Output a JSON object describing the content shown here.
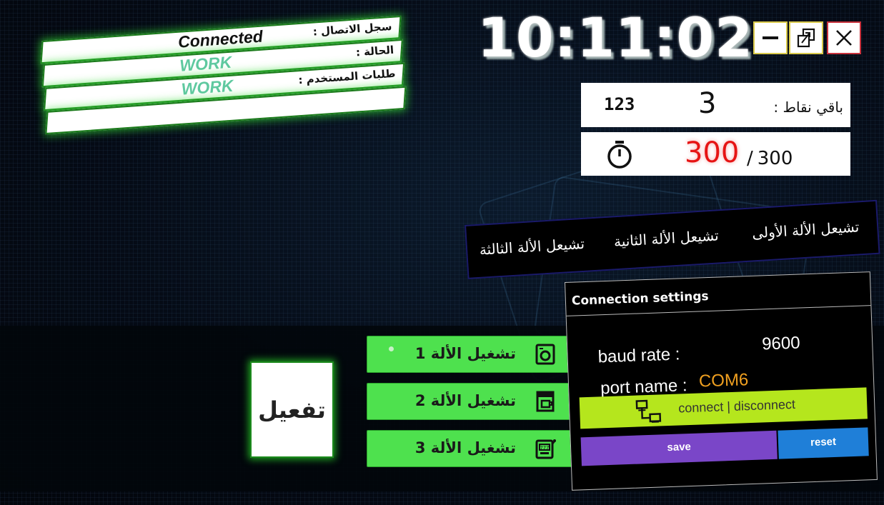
{
  "status": {
    "rows": [
      {
        "label": "سجل الاتصال :",
        "value": "Connected"
      },
      {
        "label": "الحالة :",
        "value": "WORK"
      },
      {
        "label": "طلبات المستخدم :",
        "value": "WORK"
      },
      {
        "label": "",
        "value": ""
      }
    ]
  },
  "clock": {
    "time": "10:11:02"
  },
  "window_controls": {
    "minimize": "minimize-icon",
    "maximize": "restore-icon",
    "close": "close-icon"
  },
  "points": {
    "label": "باقي نقاط :",
    "value": "3",
    "code": "123"
  },
  "timer": {
    "icon": "stopwatch-icon",
    "current": "300",
    "separator": "/",
    "total": "300"
  },
  "tabs": [
    {
      "label": "تشيعل الألة الأولى"
    },
    {
      "label": "تشيعل الألة الثانية"
    },
    {
      "label": "تشيعل الألة الثالثة"
    }
  ],
  "run_buttons": [
    {
      "label": "تشغيل الألة 1",
      "icon": "washing-machine-icon"
    },
    {
      "label": "تشغيل الألة 2",
      "icon": "coffee-machine-icon"
    },
    {
      "label": "تشغيل الألة 3",
      "icon": "slot-machine-icon"
    }
  ],
  "activate": {
    "label": "تفعيل"
  },
  "connection": {
    "title": "Connection settings",
    "baud_label": "baud rate :",
    "baud_value": "9600",
    "port_label": "port name :",
    "port_value": "COM6",
    "connect_label": "connect | disconnect",
    "connect_icon": "network-icon",
    "save_label": "save",
    "reset_label": "reset"
  },
  "colors": {
    "status_glow": "#32dc32",
    "work_text": "#5fc9a0",
    "run_button": "#4ee14e",
    "timer_red": "#e61414",
    "connect_button": "#b5e61d",
    "save_button": "#7a46c8",
    "reset_button": "#1f7fd8",
    "port_value": "#f0a020"
  }
}
